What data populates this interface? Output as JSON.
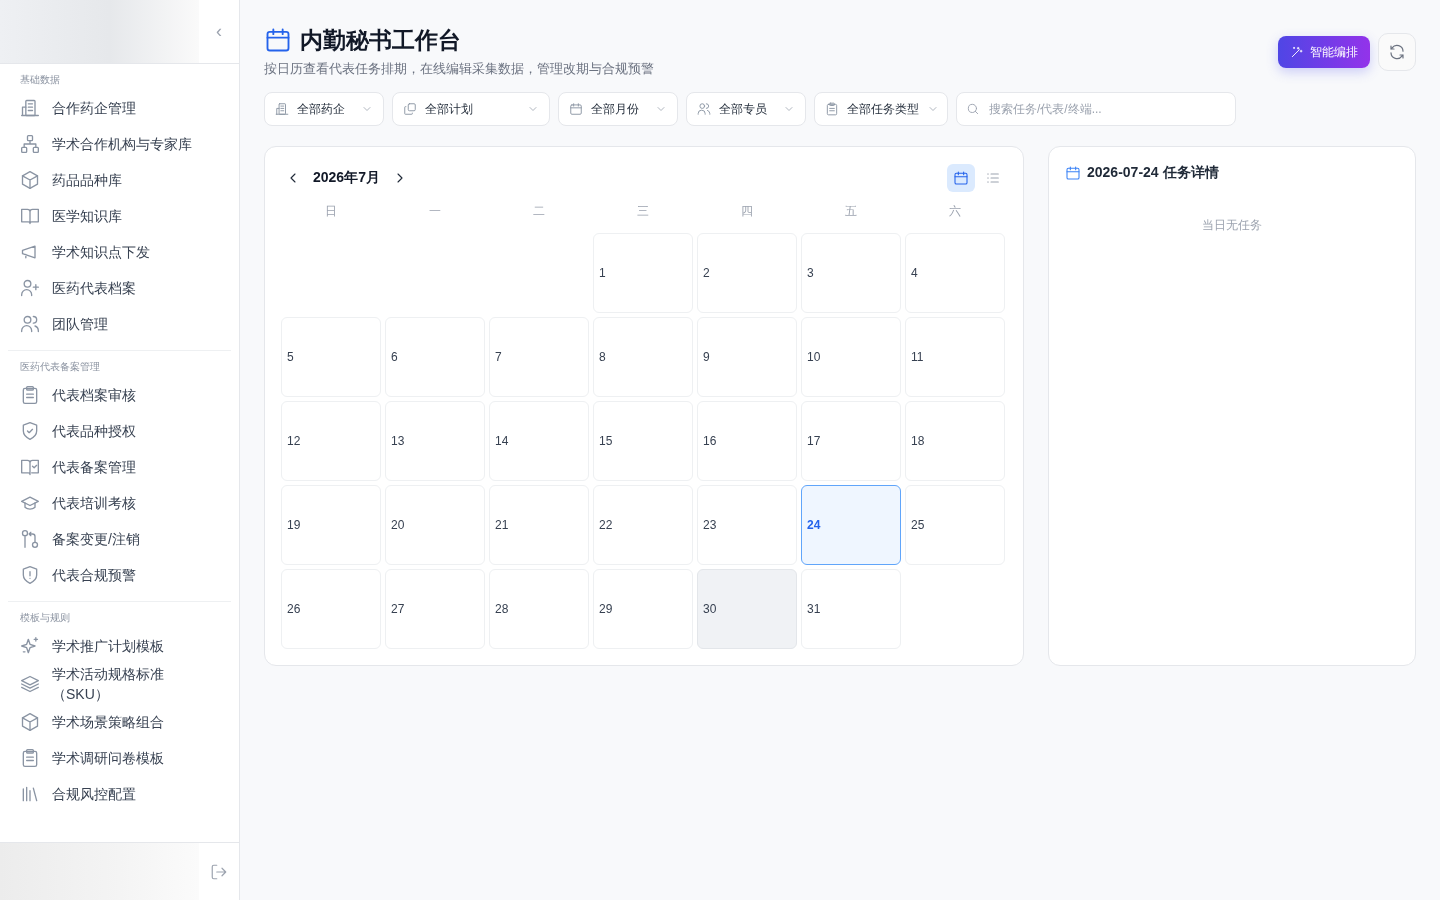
{
  "sidebar": {
    "collapse_icon": "‹",
    "sections": [
      {
        "title": "基础数据",
        "items": [
          {
            "label": "合作药企管理",
            "kind": "building"
          },
          {
            "label": "学术合作机构与专家库",
            "kind": "network"
          },
          {
            "label": "药品品种库",
            "kind": "box"
          },
          {
            "label": "医学知识库",
            "kind": "book"
          },
          {
            "label": "学术知识点下发",
            "kind": "megaphone"
          },
          {
            "label": "医药代表档案",
            "kind": "userplus"
          },
          {
            "label": "团队管理",
            "kind": "users"
          }
        ]
      },
      {
        "title": "医药代表备案管理",
        "items": [
          {
            "label": "代表档案审核",
            "kind": "clipboard"
          },
          {
            "label": "代表品种授权",
            "kind": "shieldcheck"
          },
          {
            "label": "代表备案管理",
            "kind": "bookcheck"
          },
          {
            "label": "代表培训考核",
            "kind": "cap"
          },
          {
            "label": "备案变更/注销",
            "kind": "git"
          },
          {
            "label": "代表合规预警",
            "kind": "shieldalert"
          }
        ]
      },
      {
        "title": "模板与规则",
        "items": [
          {
            "label": "学术推广计划模板",
            "kind": "sparkle"
          },
          {
            "label": "学术活动规格标准（SKU）",
            "kind": "layers"
          },
          {
            "label": "学术场景策略组合",
            "kind": "box"
          },
          {
            "label": "学术调研问卷模板",
            "kind": "clipboard"
          },
          {
            "label": "合规风控配置",
            "kind": "bars"
          }
        ]
      }
    ]
  },
  "header": {
    "title": "内勤秘书工作台",
    "subtitle": "按日历查看代表任务排期，在线编辑采集数据，管理改期与合规预警",
    "primary_button": "智能编排"
  },
  "filters": [
    {
      "label": "全部药企",
      "kind": "building"
    },
    {
      "label": "全部计划",
      "kind": "copy"
    },
    {
      "label": "全部月份",
      "kind": "calendar"
    },
    {
      "label": "全部专员",
      "kind": "users"
    },
    {
      "label": "全部任务类型",
      "kind": "clipboard"
    }
  ],
  "search": {
    "placeholder": "搜索任务/代表/终端..."
  },
  "calendar": {
    "month": "2026年7月",
    "views": [
      {
        "kind": "calendar",
        "selected": true
      },
      {
        "kind": "list",
        "selected": false
      }
    ],
    "weekdays": [
      "日",
      "一",
      "二",
      "三",
      "四",
      "五",
      "六"
    ],
    "weeks": [
      [
        {
          "kind": "blank"
        },
        {
          "kind": "blank"
        },
        {
          "kind": "blank"
        },
        {
          "kind": "day",
          "day": "1",
          "selected": false,
          "today": false
        },
        {
          "kind": "day",
          "day": "2",
          "selected": false,
          "today": false
        },
        {
          "kind": "day",
          "day": "3",
          "selected": false,
          "today": false
        },
        {
          "kind": "day",
          "day": "4",
          "selected": false,
          "today": false
        }
      ],
      [
        {
          "kind": "day",
          "day": "5",
          "selected": false,
          "today": false
        },
        {
          "kind": "day",
          "day": "6",
          "selected": false,
          "today": false
        },
        {
          "kind": "day",
          "day": "7",
          "selected": false,
          "today": false
        },
        {
          "kind": "day",
          "day": "8",
          "selected": false,
          "today": false
        },
        {
          "kind": "day",
          "day": "9",
          "selected": false,
          "today": false
        },
        {
          "kind": "day",
          "day": "10",
          "selected": false,
          "today": false
        },
        {
          "kind": "day",
          "day": "11",
          "selected": false,
          "today": false
        }
      ],
      [
        {
          "kind": "day",
          "day": "12",
          "selected": false,
          "today": false
        },
        {
          "kind": "day",
          "day": "13",
          "selected": false,
          "today": false
        },
        {
          "kind": "day",
          "day": "14",
          "selected": false,
          "today": false
        },
        {
          "kind": "day",
          "day": "15",
          "selected": false,
          "today": false
        },
        {
          "kind": "day",
          "day": "16",
          "selected": false,
          "today": false
        },
        {
          "kind": "day",
          "day": "17",
          "selected": false,
          "today": false
        },
        {
          "kind": "day",
          "day": "18",
          "selected": false,
          "today": false
        }
      ],
      [
        {
          "kind": "day",
          "day": "19",
          "selected": false,
          "today": false
        },
        {
          "kind": "day",
          "day": "20",
          "selected": false,
          "today": false
        },
        {
          "kind": "day",
          "day": "21",
          "selected": false,
          "today": false
        },
        {
          "kind": "day",
          "day": "22",
          "selected": false,
          "today": false
        },
        {
          "kind": "day",
          "day": "23",
          "selected": false,
          "today": false
        },
        {
          "kind": "day",
          "day": "24",
          "selected": true,
          "today": false
        },
        {
          "kind": "day",
          "day": "25",
          "selected": false,
          "today": false
        }
      ],
      [
        {
          "kind": "day",
          "day": "26",
          "selected": false,
          "today": false
        },
        {
          "kind": "day",
          "day": "27",
          "selected": false,
          "today": false
        },
        {
          "kind": "day",
          "day": "28",
          "selected": false,
          "today": false
        },
        {
          "kind": "day",
          "day": "29",
          "selected": false,
          "today": false
        },
        {
          "kind": "day",
          "day": "30",
          "selected": false,
          "today": true
        },
        {
          "kind": "day",
          "day": "31",
          "selected": false,
          "today": false
        },
        {
          "kind": "blank"
        }
      ]
    ]
  },
  "details": {
    "title": "2026-07-24 任务详情",
    "empty_text": "当日无任务"
  }
}
